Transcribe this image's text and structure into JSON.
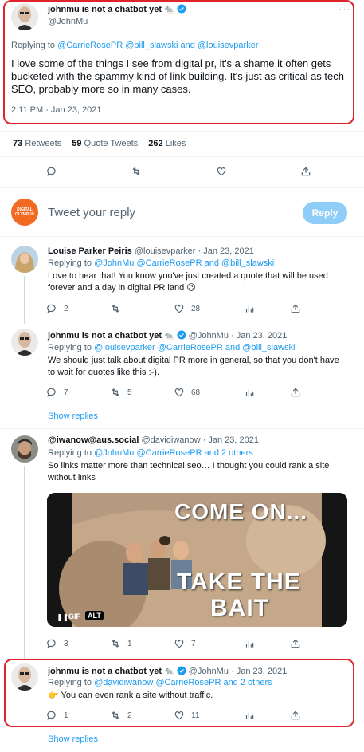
{
  "main_tweet": {
    "author_name": "johnmu is not a chatbot yet",
    "author_emoji": "🐀",
    "handle": "@JohnMu",
    "replying_prefix": "Replying to",
    "replying_to": "@CarrieRosePR @bill_slawski and @louisevparker",
    "text": "I love some of the things I see from digital pr, it's a shame it often gets bucketed with the spammy kind of link building. It's just as critical as tech SEO, probably more so in many cases.",
    "timestamp": "2:11 PM · Jan 23, 2021",
    "more_icon": "more-dots-icon"
  },
  "stats": {
    "retweets_count": "73",
    "retweets_label": "Retweets",
    "quotes_count": "59",
    "quotes_label": "Quote Tweets",
    "likes_count": "262",
    "likes_label": "Likes"
  },
  "composer": {
    "avatar_text": "DIGITAL OLYMPUS",
    "placeholder": "Tweet your reply",
    "reply_button": "Reply"
  },
  "replies": [
    {
      "author_name": "Louise Parker Peiris",
      "handle": "@louisevparker",
      "date": "Jan 23, 2021",
      "replying_prefix": "Replying to",
      "replying_to": "@JohnMu @CarrieRosePR and @bill_slawski",
      "text": "Love to hear that! You know you've just created a quote that will be used forever and a day in digital PR land 😉",
      "reply_count": "2",
      "retweet_count": "",
      "like_count": "28"
    },
    {
      "author_name": "johnmu is not a chatbot yet",
      "author_emoji": "🐀",
      "handle": "@JohnMu",
      "date": "Jan 23, 2021",
      "replying_prefix": "Replying to",
      "replying_to": "@louisevparker @CarrieRosePR and @bill_slawski",
      "text": "We should just talk about digital PR more in general, so that you don't have to wait for quotes like this :-).",
      "reply_count": "7",
      "retweet_count": "5",
      "like_count": "68",
      "show_replies": "Show replies"
    },
    {
      "author_name": "@iwanow@aus.social",
      "handle": "@davidiwanow",
      "date": "Jan 23, 2021",
      "replying_prefix": "Replying to",
      "replying_to": "@JohnMu @CarrieRosePR and 2 others",
      "text": "So links matter more than technical seo… I thought you could rank a site without links",
      "media_line1": "COME ON...",
      "media_line2": "TAKE THE",
      "media_line3": "BAIT",
      "gif_badge": "GIF",
      "alt_badge": "ALT",
      "reply_count": "3",
      "retweet_count": "1",
      "like_count": "7"
    },
    {
      "author_name": "johnmu is not a chatbot yet",
      "author_emoji": "🐀",
      "handle": "@JohnMu",
      "date": "Jan 23, 2021",
      "replying_prefix": "Replying to",
      "replying_to": "@davidiwanow @CarrieRosePR and 2 others",
      "text": "👉 You can even rank a site without traffic.",
      "reply_count": "1",
      "retweet_count": "2",
      "like_count": "11",
      "show_replies": "Show replies"
    }
  ],
  "colors": {
    "accent": "#1d9bf0",
    "highlight_border": "#e0242b",
    "muted": "#536471",
    "reply_button_bg": "#8ecdf8",
    "brand_orange": "#f26a21"
  }
}
